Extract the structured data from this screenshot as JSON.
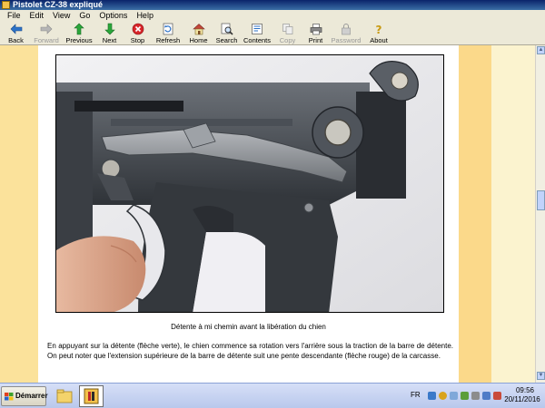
{
  "window": {
    "title": "Pistolet CZ-38 expliqué"
  },
  "menu": [
    "File",
    "Edit",
    "View",
    "Go",
    "Options",
    "Help"
  ],
  "toolbar": [
    {
      "label": "Back",
      "icon": "back-arrow-icon",
      "enabled": true
    },
    {
      "label": "Forward",
      "icon": "forward-arrow-icon",
      "enabled": false
    },
    {
      "label": "Previous",
      "icon": "up-arrow-icon",
      "enabled": true
    },
    {
      "label": "Next",
      "icon": "down-arrow-icon",
      "enabled": true
    },
    {
      "label": "Stop",
      "icon": "stop-icon",
      "enabled": true
    },
    {
      "label": "Refresh",
      "icon": "refresh-icon",
      "enabled": true
    },
    {
      "label": "Home",
      "icon": "home-icon",
      "enabled": true
    },
    {
      "label": "Search",
      "icon": "search-icon",
      "enabled": true
    },
    {
      "label": "Contents",
      "icon": "contents-icon",
      "enabled": true
    },
    {
      "label": "Copy",
      "icon": "copy-icon",
      "enabled": false
    },
    {
      "label": "Print",
      "icon": "print-icon",
      "enabled": true
    },
    {
      "label": "Password",
      "icon": "password-icon",
      "enabled": false
    },
    {
      "label": "About",
      "icon": "about-icon",
      "enabled": true
    }
  ],
  "content": {
    "caption": "Détente à mi chemin avant la libération du chien",
    "paragraph": "En appuyant sur la détente (flèche verte), le chien commence sa rotation vers l'arrière sous la traction de la barre de détente. On peut noter que l'extension supérieure de la barre de détente suit une pente descendante (flèche rouge) de la carcasse."
  },
  "taskbar": {
    "start_label": "Démarrer",
    "language": "FR",
    "time": "09:56",
    "date": "20/11/2016"
  },
  "colors": {
    "page_bg": "#fbf3cf",
    "left_strip": "#fbe29b",
    "right_strip": "#fbd98a",
    "titlebar": "#0a246a"
  }
}
